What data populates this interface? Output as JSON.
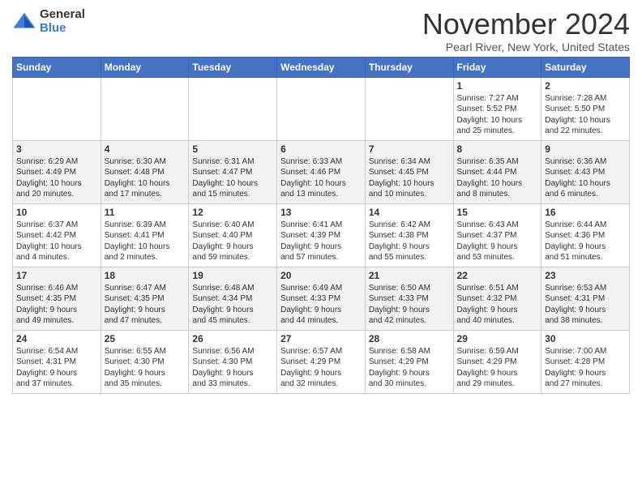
{
  "logo": {
    "general": "General",
    "blue": "Blue"
  },
  "title": "November 2024",
  "location": "Pearl River, New York, United States",
  "headers": [
    "Sunday",
    "Monday",
    "Tuesday",
    "Wednesday",
    "Thursday",
    "Friday",
    "Saturday"
  ],
  "weeks": [
    [
      {
        "day": "",
        "info": ""
      },
      {
        "day": "",
        "info": ""
      },
      {
        "day": "",
        "info": ""
      },
      {
        "day": "",
        "info": ""
      },
      {
        "day": "",
        "info": ""
      },
      {
        "day": "1",
        "info": "Sunrise: 7:27 AM\nSunset: 5:52 PM\nDaylight: 10 hours\nand 25 minutes."
      },
      {
        "day": "2",
        "info": "Sunrise: 7:28 AM\nSunset: 5:50 PM\nDaylight: 10 hours\nand 22 minutes."
      }
    ],
    [
      {
        "day": "3",
        "info": "Sunrise: 6:29 AM\nSunset: 4:49 PM\nDaylight: 10 hours\nand 20 minutes."
      },
      {
        "day": "4",
        "info": "Sunrise: 6:30 AM\nSunset: 4:48 PM\nDaylight: 10 hours\nand 17 minutes."
      },
      {
        "day": "5",
        "info": "Sunrise: 6:31 AM\nSunset: 4:47 PM\nDaylight: 10 hours\nand 15 minutes."
      },
      {
        "day": "6",
        "info": "Sunrise: 6:33 AM\nSunset: 4:46 PM\nDaylight: 10 hours\nand 13 minutes."
      },
      {
        "day": "7",
        "info": "Sunrise: 6:34 AM\nSunset: 4:45 PM\nDaylight: 10 hours\nand 10 minutes."
      },
      {
        "day": "8",
        "info": "Sunrise: 6:35 AM\nSunset: 4:44 PM\nDaylight: 10 hours\nand 8 minutes."
      },
      {
        "day": "9",
        "info": "Sunrise: 6:36 AM\nSunset: 4:43 PM\nDaylight: 10 hours\nand 6 minutes."
      }
    ],
    [
      {
        "day": "10",
        "info": "Sunrise: 6:37 AM\nSunset: 4:42 PM\nDaylight: 10 hours\nand 4 minutes."
      },
      {
        "day": "11",
        "info": "Sunrise: 6:39 AM\nSunset: 4:41 PM\nDaylight: 10 hours\nand 2 minutes."
      },
      {
        "day": "12",
        "info": "Sunrise: 6:40 AM\nSunset: 4:40 PM\nDaylight: 9 hours\nand 59 minutes."
      },
      {
        "day": "13",
        "info": "Sunrise: 6:41 AM\nSunset: 4:39 PM\nDaylight: 9 hours\nand 57 minutes."
      },
      {
        "day": "14",
        "info": "Sunrise: 6:42 AM\nSunset: 4:38 PM\nDaylight: 9 hours\nand 55 minutes."
      },
      {
        "day": "15",
        "info": "Sunrise: 6:43 AM\nSunset: 4:37 PM\nDaylight: 9 hours\nand 53 minutes."
      },
      {
        "day": "16",
        "info": "Sunrise: 6:44 AM\nSunset: 4:36 PM\nDaylight: 9 hours\nand 51 minutes."
      }
    ],
    [
      {
        "day": "17",
        "info": "Sunrise: 6:46 AM\nSunset: 4:35 PM\nDaylight: 9 hours\nand 49 minutes."
      },
      {
        "day": "18",
        "info": "Sunrise: 6:47 AM\nSunset: 4:35 PM\nDaylight: 9 hours\nand 47 minutes."
      },
      {
        "day": "19",
        "info": "Sunrise: 6:48 AM\nSunset: 4:34 PM\nDaylight: 9 hours\nand 45 minutes."
      },
      {
        "day": "20",
        "info": "Sunrise: 6:49 AM\nSunset: 4:33 PM\nDaylight: 9 hours\nand 44 minutes."
      },
      {
        "day": "21",
        "info": "Sunrise: 6:50 AM\nSunset: 4:33 PM\nDaylight: 9 hours\nand 42 minutes."
      },
      {
        "day": "22",
        "info": "Sunrise: 6:51 AM\nSunset: 4:32 PM\nDaylight: 9 hours\nand 40 minutes."
      },
      {
        "day": "23",
        "info": "Sunrise: 6:53 AM\nSunset: 4:31 PM\nDaylight: 9 hours\nand 38 minutes."
      }
    ],
    [
      {
        "day": "24",
        "info": "Sunrise: 6:54 AM\nSunset: 4:31 PM\nDaylight: 9 hours\nand 37 minutes."
      },
      {
        "day": "25",
        "info": "Sunrise: 6:55 AM\nSunset: 4:30 PM\nDaylight: 9 hours\nand 35 minutes."
      },
      {
        "day": "26",
        "info": "Sunrise: 6:56 AM\nSunset: 4:30 PM\nDaylight: 9 hours\nand 33 minutes."
      },
      {
        "day": "27",
        "info": "Sunrise: 6:57 AM\nSunset: 4:29 PM\nDaylight: 9 hours\nand 32 minutes."
      },
      {
        "day": "28",
        "info": "Sunrise: 6:58 AM\nSunset: 4:29 PM\nDaylight: 9 hours\nand 30 minutes."
      },
      {
        "day": "29",
        "info": "Sunrise: 6:59 AM\nSunset: 4:29 PM\nDaylight: 9 hours\nand 29 minutes."
      },
      {
        "day": "30",
        "info": "Sunrise: 7:00 AM\nSunset: 4:28 PM\nDaylight: 9 hours\nand 27 minutes."
      }
    ]
  ]
}
